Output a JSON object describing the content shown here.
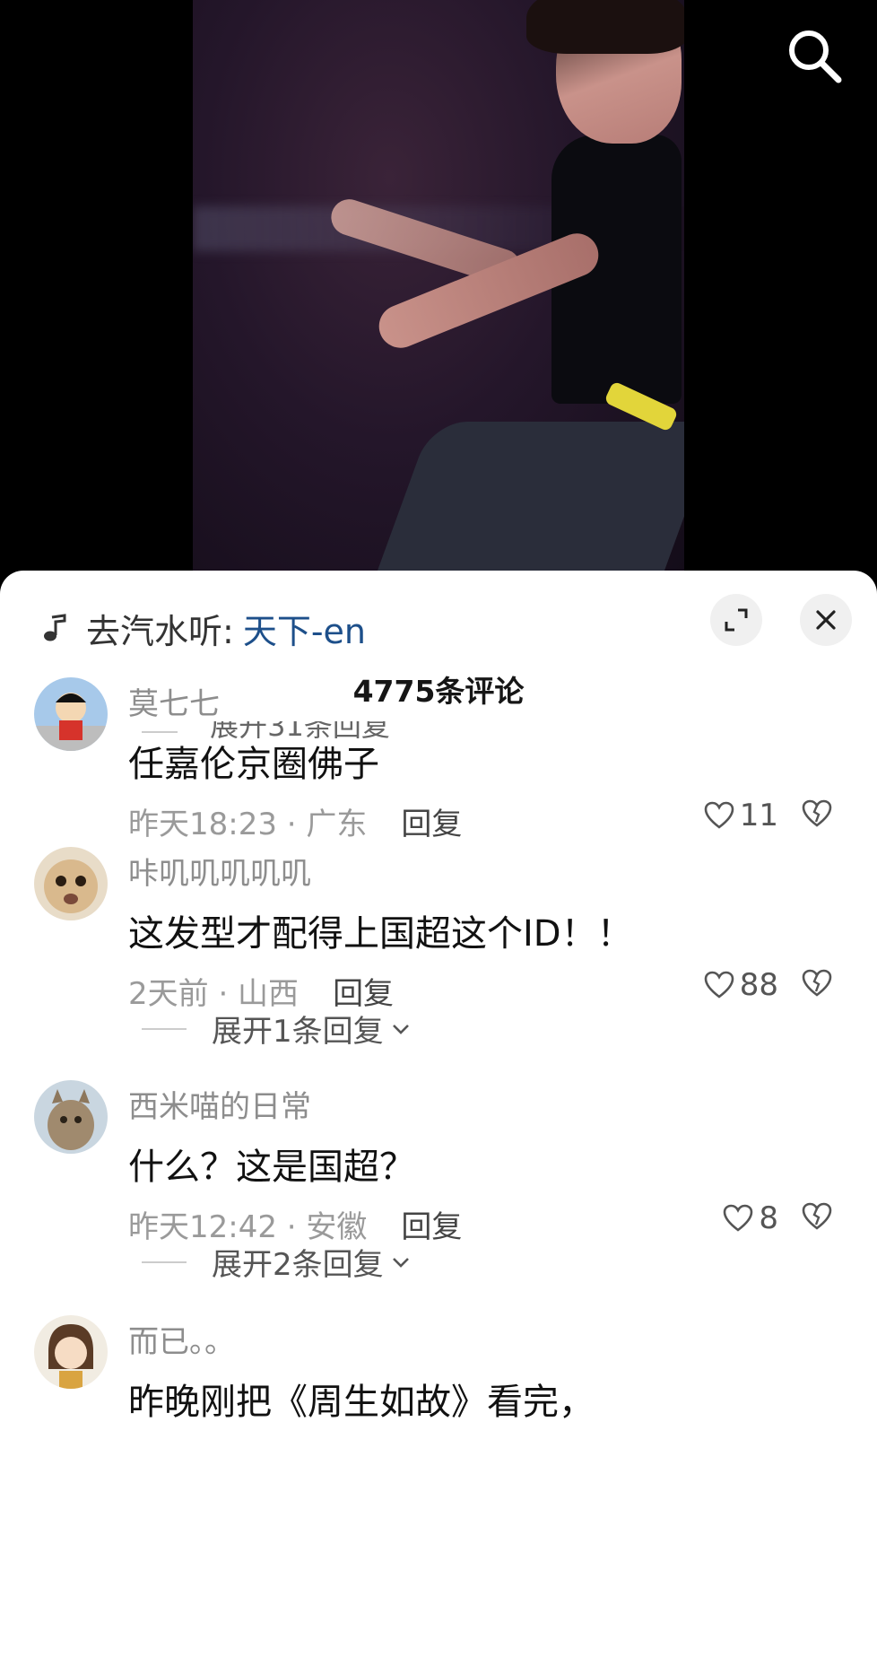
{
  "header": {
    "search_icon": "search-icon"
  },
  "sheet": {
    "music_prefix": "去汽水听:",
    "song": "天下-en",
    "count_title": "4775条评论",
    "partial_reply": "展开31条回复"
  },
  "comments": [
    {
      "name": "莫七七",
      "text": "任嘉伦京圈佛子",
      "time": "昨天18:23 · 广东",
      "reply": "回复",
      "likes": "11",
      "expand": ""
    },
    {
      "name": "咔叽叽叽叽叽",
      "text": "这发型才配得上国超这个ID！！",
      "time": "2天前 · 山西",
      "reply": "回复",
      "likes": "88",
      "expand": "展开1条回复"
    },
    {
      "name": "西米喵的日常",
      "text": "什么？这是国超？",
      "time": "昨天12:42 · 安徽",
      "reply": "回复",
      "likes": "8",
      "expand": "展开2条回复"
    },
    {
      "name": "而已。。",
      "text": "昨晚刚把《周生如故》看完，"
    }
  ],
  "colors": {
    "song_link": "#1d4f8a",
    "sheet_bg": "#ffffff",
    "video_bg": "#000000"
  }
}
